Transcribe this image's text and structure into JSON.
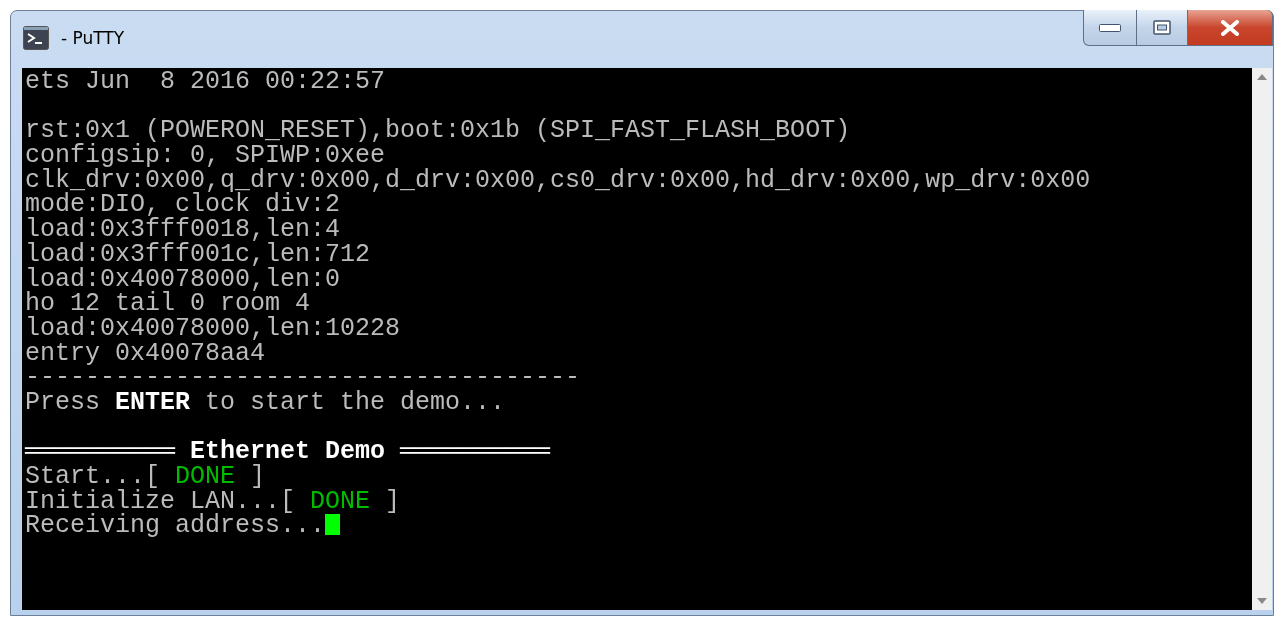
{
  "window": {
    "title": "- PuTTY"
  },
  "terminal": {
    "cursor_visible": true,
    "blocks": [
      {
        "lines": [
          [
            {
              "text": "ets Jun  8 2016 00:22:57",
              "kind": "plain"
            }
          ]
        ]
      },
      {
        "lines": [
          [
            {
              "text": "rst:0x1 (POWERON_RESET),boot:0x1b (SPI_FAST_FLASH_BOOT)",
              "kind": "plain"
            }
          ],
          [
            {
              "text": "configsip: 0, SPIWP:0xee",
              "kind": "plain"
            }
          ],
          [
            {
              "text": "clk_drv:0x00,q_drv:0x00,d_drv:0x00,cs0_drv:0x00,hd_drv:0x00,wp_drv:0x00",
              "kind": "plain"
            }
          ],
          [
            {
              "text": "mode:DIO, clock div:2",
              "kind": "plain"
            }
          ],
          [
            {
              "text": "load:0x3fff0018,len:4",
              "kind": "plain"
            }
          ],
          [
            {
              "text": "load:0x3fff001c,len:712",
              "kind": "plain"
            }
          ],
          [
            {
              "text": "load:0x40078000,len:0",
              "kind": "plain"
            }
          ],
          [
            {
              "text": "ho 12 tail 0 room 4",
              "kind": "plain"
            }
          ],
          [
            {
              "text": "load:0x40078000,len:10228",
              "kind": "plain"
            }
          ],
          [
            {
              "text": "entry 0x40078aa4",
              "kind": "plain"
            }
          ],
          [
            {
              "text": "-------------------------------------",
              "kind": "plain"
            }
          ],
          [
            {
              "text": "Press ",
              "kind": "plain"
            },
            {
              "text": "ENTER",
              "kind": "bold"
            },
            {
              "text": " to start the demo...",
              "kind": "plain"
            }
          ]
        ]
      },
      {
        "lines": [
          [
            {
              "text": "══════════ Ethernet Demo ══════════",
              "kind": "bold"
            }
          ],
          [
            {
              "text": "Start...[ ",
              "kind": "plain"
            },
            {
              "text": "DONE",
              "kind": "ok"
            },
            {
              "text": " ]",
              "kind": "plain"
            }
          ],
          [
            {
              "text": "Initialize LAN...[ ",
              "kind": "plain"
            },
            {
              "text": "DONE",
              "kind": "ok"
            },
            {
              "text": " ]",
              "kind": "plain"
            }
          ],
          [
            {
              "text": "Receiving address...",
              "kind": "plain"
            }
          ]
        ]
      }
    ]
  }
}
